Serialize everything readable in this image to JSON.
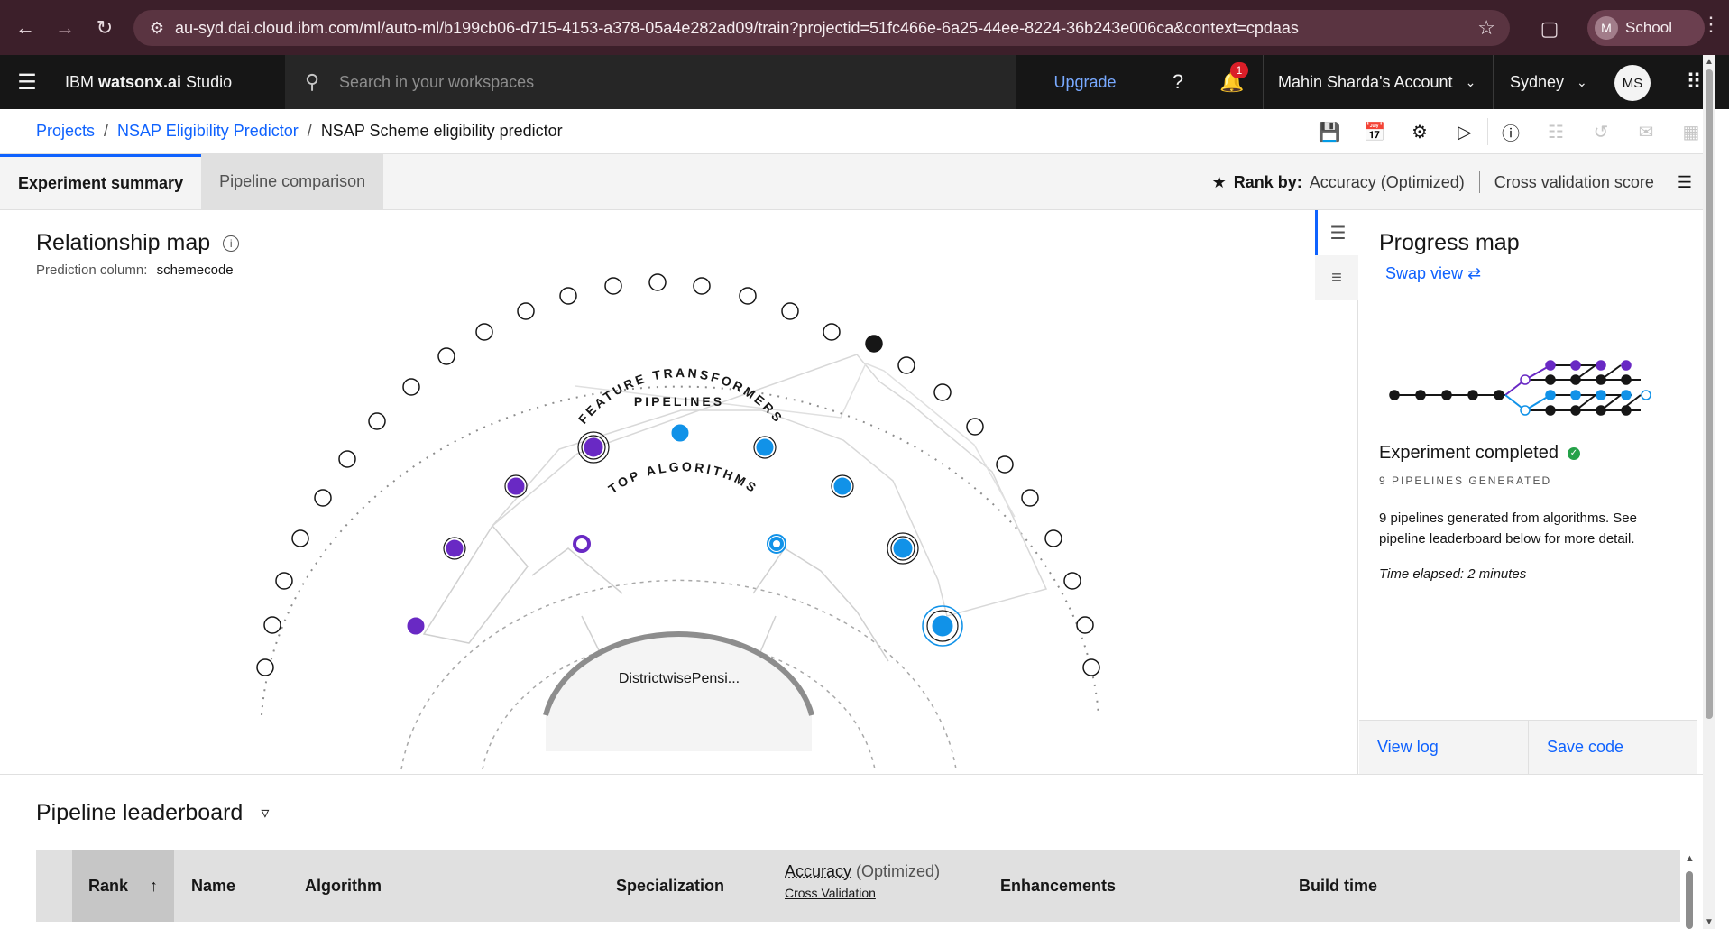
{
  "browser": {
    "url": "au-syd.dai.cloud.ibm.com/ml/auto-ml/b199cb06-d715-4153-a378-05a4e282ad09/train?projectid=51fc466e-6a25-44ee-8224-36b243e006ca&context=cpdaas",
    "profile_initial": "M",
    "profile_label": "School"
  },
  "app": {
    "brand_prefix": "IBM ",
    "brand_bold": "watsonx.ai",
    "brand_suffix": " Studio",
    "search_placeholder": "Search in your workspaces",
    "upgrade_label": "Upgrade",
    "notification_count": "1",
    "account_label": "Mahin Sharda's Account",
    "region_label": "Sydney",
    "avatar_initials": "MS"
  },
  "breadcrumb": {
    "items": [
      "Projects",
      "NSAP Eligibility Predictor"
    ],
    "current": "NSAP Scheme eligibility predictor"
  },
  "tabs": {
    "experiment_summary": "Experiment summary",
    "pipeline_comparison": "Pipeline comparison"
  },
  "rank": {
    "label": "Rank by:",
    "metric": "Accuracy (Optimized)",
    "score": "Cross validation score"
  },
  "relationship_map": {
    "title": "Relationship map",
    "prediction_label": "Prediction column:",
    "prediction_value": "schemecode",
    "ring_feature": "FEATURE TRANSFORMERS",
    "ring_pipelines": "PIPELINES",
    "ring_algorithms": "TOP ALGORITHMS",
    "center_label": "DistrictwisePensi..."
  },
  "progress_map": {
    "title": "Progress map",
    "swap_label": "Swap view",
    "status": "Experiment completed",
    "pipelines_generated": "9 PIPELINES GENERATED",
    "description": "9 pipelines generated from algorithms. See pipeline leaderboard below for more detail.",
    "elapsed": "Time elapsed: 2 minutes",
    "view_log": "View log",
    "save_code": "Save code"
  },
  "leaderboard": {
    "title": "Pipeline leaderboard",
    "columns": {
      "rank": "Rank",
      "name": "Name",
      "algorithm": "Algorithm",
      "specialization": "Specialization",
      "accuracy": "Accuracy",
      "accuracy_opt": "(Optimized)",
      "cross_validation": "Cross Validation",
      "enhancements": "Enhancements",
      "build_time": "Build time"
    }
  },
  "colors": {
    "purple": "#6929c4",
    "blue": "#1192e8",
    "ibm_blue": "#0f62fe"
  }
}
